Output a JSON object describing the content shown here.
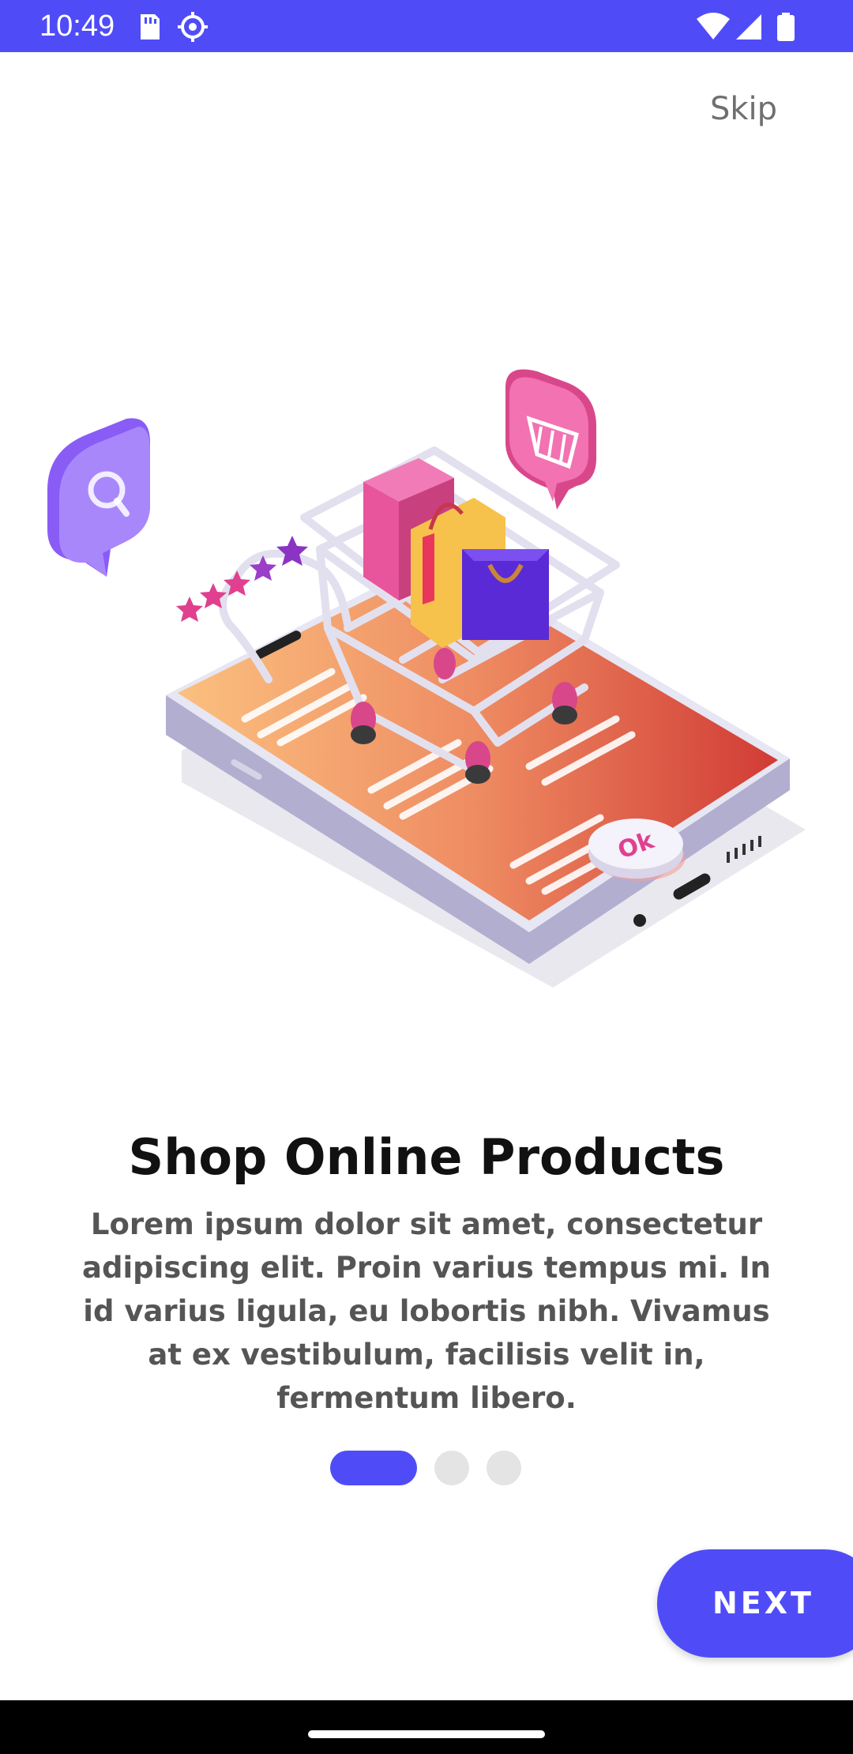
{
  "status_bar": {
    "time": "10:49",
    "icons": [
      "sd-card-icon",
      "settings-icon",
      "wifi-icon",
      "signal-icon",
      "battery-icon"
    ],
    "background_color": "#4f4cf7"
  },
  "onboarding": {
    "skip_label": "Skip",
    "title": "Shop Online Products",
    "description": "Lorem ipsum dolor sit amet, consectetur adipiscing elit. Proin varius tempus mi. In id varius ligula, eu lobortis nibh. Vivamus at ex vestibulum, facilisis velit in, fermentum libero.",
    "illustration": {
      "subject": "shopping-cart-on-phone-illustration",
      "ok_badge_text": "Ok"
    },
    "pager": {
      "total_pages": 3,
      "current_page": 1
    },
    "next_label": "NEXT"
  },
  "colors": {
    "accent": "#4f4cf7",
    "title": "#111111",
    "body": "#555555",
    "skip": "#6f6f6f",
    "inactive_dot": "#e4e4e4"
  }
}
